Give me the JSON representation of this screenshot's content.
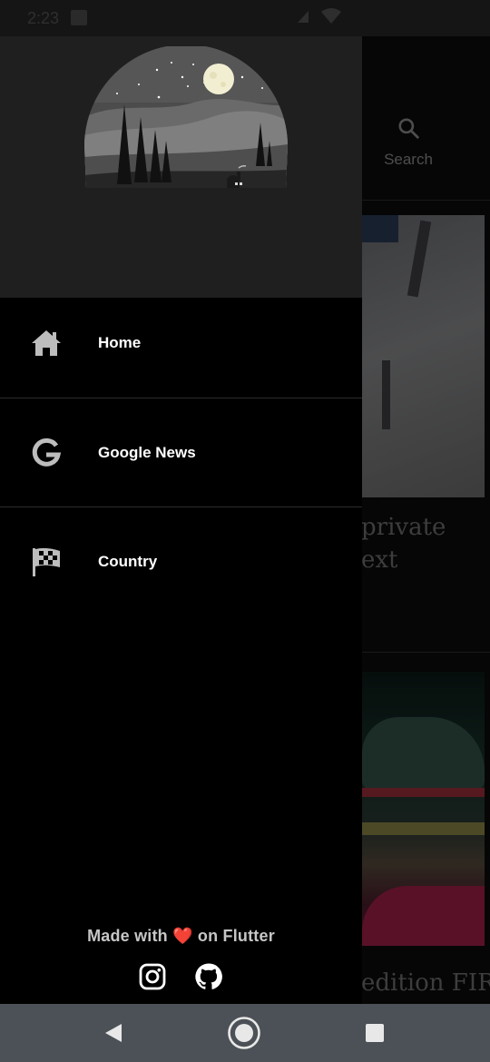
{
  "status_bar": {
    "time": "2:23"
  },
  "background": {
    "search_label": "Search",
    "headline_1_line1": "private",
    "headline_1_line2": "ext",
    "headline_2": "edition FIR"
  },
  "drawer": {
    "items": [
      {
        "label": "Home",
        "icon": "home-icon"
      },
      {
        "label": "Google News",
        "icon": "google-icon"
      },
      {
        "label": "Country",
        "icon": "checkered-flag-icon"
      }
    ],
    "footer": {
      "made_with": "Made with",
      "heart": "❤️",
      "on_flutter": "on Flutter"
    },
    "social": [
      {
        "name": "instagram-icon"
      },
      {
        "name": "github-icon"
      }
    ]
  },
  "colors": {
    "drawer_bg": "#000000",
    "header_bg": "#1f1f1f",
    "nav_bar": "#4c5157",
    "heart": "#e2262b"
  }
}
